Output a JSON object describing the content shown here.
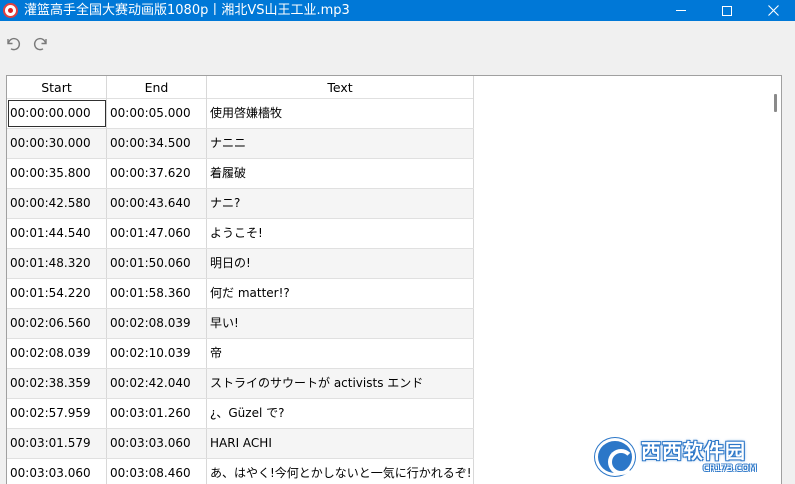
{
  "window": {
    "title": "灌篮高手全国大赛动画版1080p丨湘北VS山王工业.mp3",
    "controls": [
      "minimize",
      "maximize",
      "close"
    ]
  },
  "toolbar": {
    "icons": [
      "undo-icon",
      "redo-icon"
    ]
  },
  "table": {
    "headers": {
      "start": "Start",
      "end": "End",
      "text": "Text"
    },
    "rows": [
      {
        "start": "00:00:00.000",
        "end": "00:00:05.000",
        "text": "使用啓嫌檣牧"
      },
      {
        "start": "00:00:30.000",
        "end": "00:00:34.500",
        "text": "ナニニ"
      },
      {
        "start": "00:00:35.800",
        "end": "00:00:37.620",
        "text": "着履破"
      },
      {
        "start": "00:00:42.580",
        "end": "00:00:43.640",
        "text": "ナニ?"
      },
      {
        "start": "00:01:44.540",
        "end": "00:01:47.060",
        "text": "ようこそ!"
      },
      {
        "start": "00:01:48.320",
        "end": "00:01:50.060",
        "text": "明日の!"
      },
      {
        "start": "00:01:54.220",
        "end": "00:01:58.360",
        "text": "何だ matter!?"
      },
      {
        "start": "00:02:06.560",
        "end": "00:02:08.039",
        "text": "早い!"
      },
      {
        "start": "00:02:08.039",
        "end": "00:02:10.039",
        "text": "帝"
      },
      {
        "start": "00:02:38.359",
        "end": "00:02:42.040",
        "text": "ストライのサウートが activists エンド"
      },
      {
        "start": "00:02:57.959",
        "end": "00:03:01.260",
        "text": "¿、Güzel で?"
      },
      {
        "start": "00:03:01.579",
        "end": "00:03:03.060",
        "text": "HARI ACHI"
      },
      {
        "start": "00:03:03.060",
        "end": "00:03:08.460",
        "text": "あ、はやく!今何とかしないと一気に行かれるぞ!"
      }
    ]
  },
  "watermark": {
    "brand": "西西软件园",
    "url": "CR173.COM"
  },
  "colors": {
    "titlebar": "#0078d7",
    "window_bg": "#f0f0f0",
    "row_alt": "#f5f5f5",
    "watermark": "#2c77c8"
  }
}
